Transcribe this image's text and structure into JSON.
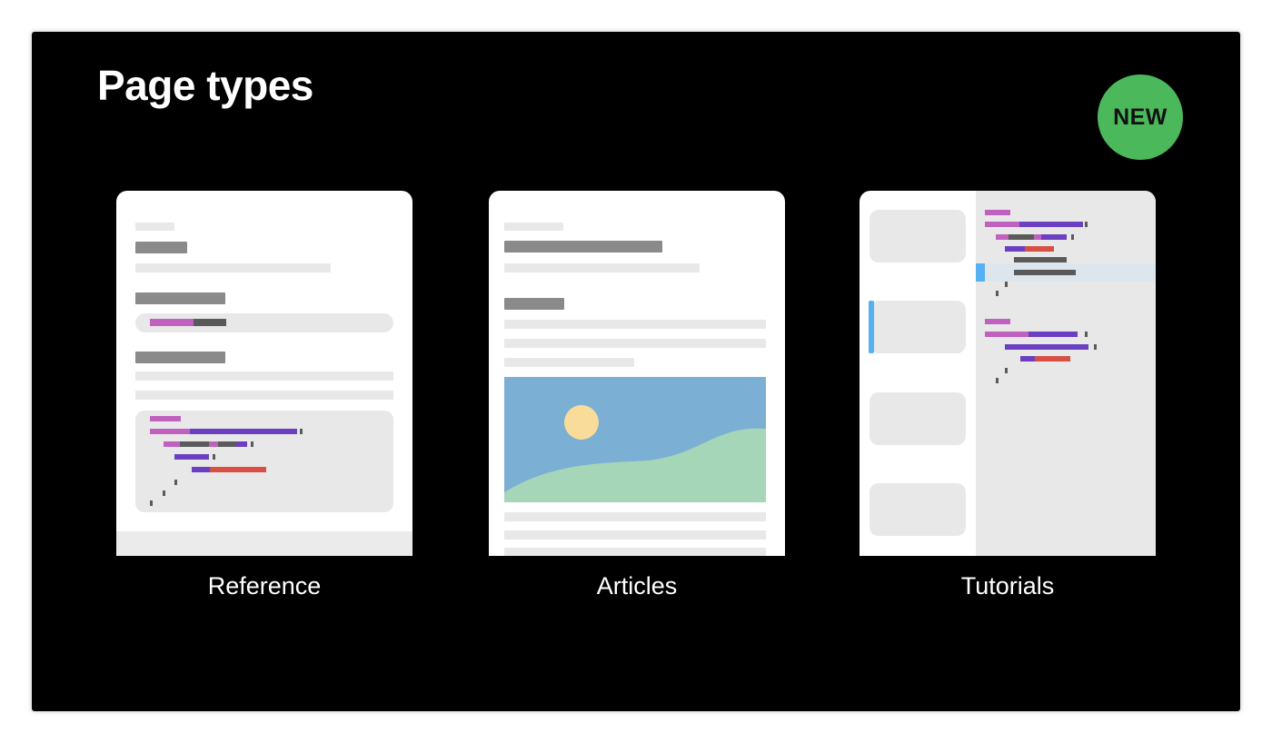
{
  "slide": {
    "title": "Page types",
    "badge": "NEW"
  },
  "colors": {
    "background": "#000000",
    "badge": "#4cb85c",
    "gray_bar": "#8a8a8a",
    "light_bar": "#e8e8e8",
    "code_pink": "#c061c0",
    "code_purple": "#6a3fc1",
    "code_dark": "#5a5a5a",
    "code_red": "#d84f43",
    "sky": "#7bafd4",
    "sun": "#f9dc99",
    "hill": "#a5d6b7",
    "highlight": "#dde6ec",
    "accent_blue": "#56b1f2"
  },
  "cards": [
    {
      "label": "Reference",
      "icon": "reference-page-icon"
    },
    {
      "label": "Articles",
      "icon": "article-page-icon"
    },
    {
      "label": "Tutorials",
      "icon": "tutorial-page-icon"
    }
  ]
}
